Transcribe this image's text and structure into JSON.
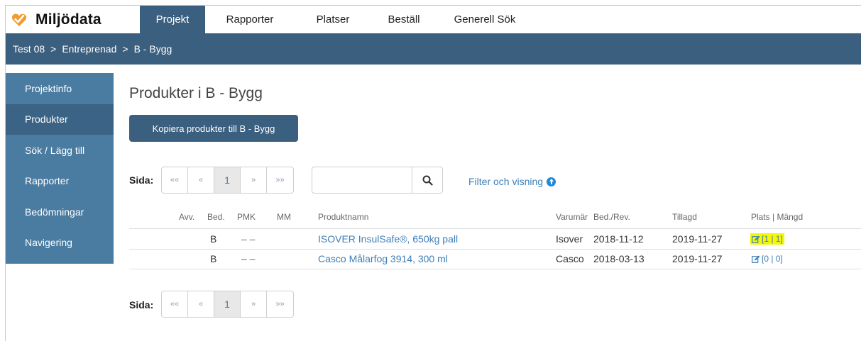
{
  "brand": {
    "name": "Miljödata",
    "logo_icon": "miljodata-heart-check-logo",
    "logo_color": "#f29a2e"
  },
  "nav": {
    "items": [
      {
        "label": "Projekt",
        "active": true
      },
      {
        "label": "Rapporter",
        "active": false
      },
      {
        "label": "Platser",
        "active": false
      },
      {
        "label": "Beställ",
        "active": false
      },
      {
        "label": "Generell Sök",
        "active": false
      }
    ]
  },
  "breadcrumb": {
    "items": [
      "Test 08",
      "Entreprenad",
      "B - Bygg"
    ],
    "separator": ">"
  },
  "sidebar": {
    "items": [
      {
        "label": "Projektinfo",
        "active": false
      },
      {
        "label": "Produkter",
        "active": true
      },
      {
        "label": "Sök / Lägg till",
        "active": false
      },
      {
        "label": "Rapporter",
        "active": false
      },
      {
        "label": "Bedömningar",
        "active": false
      },
      {
        "label": "Navigering",
        "active": false
      }
    ]
  },
  "main": {
    "title": "Produkter i B - Bygg",
    "copy_button": "Kopiera produkter till B - Bygg",
    "pager": {
      "label": "Sida:",
      "first": "««",
      "prev": "«",
      "current": "1",
      "next": "»",
      "last": "»»"
    },
    "search": {
      "placeholder": "",
      "icon": "search-icon"
    },
    "filter_link": "Filter och visning",
    "table": {
      "headers": {
        "avv": "Avv.",
        "bed": "Bed.",
        "pmk": "PMK",
        "mm": "MM",
        "name": "Produktnamn",
        "brand": "Varumär",
        "bedrev": "Bed./Rev.",
        "added": "Tillagd",
        "plats": "Plats | Mängd"
      },
      "rows": [
        {
          "bed": "B",
          "pmk": "– –",
          "name": "ISOVER InsulSafe®, 650kg pall",
          "brand": "Isover",
          "bedrev": "2018-11-12",
          "added": "2019-11-27",
          "plats": "[1 | 1]",
          "highlight": true
        },
        {
          "bed": "B",
          "pmk": "– –",
          "name": "Casco Målarfog 3914, 300 ml",
          "brand": "Casco",
          "bedrev": "2018-03-13",
          "added": "2019-11-27",
          "plats": "[0 | 0]",
          "highlight": false
        }
      ]
    }
  },
  "colors": {
    "primary": "#3b5f7e",
    "sidebar": "#4a7ba0",
    "link": "#3f7fb8",
    "highlight": "#f6f800"
  }
}
